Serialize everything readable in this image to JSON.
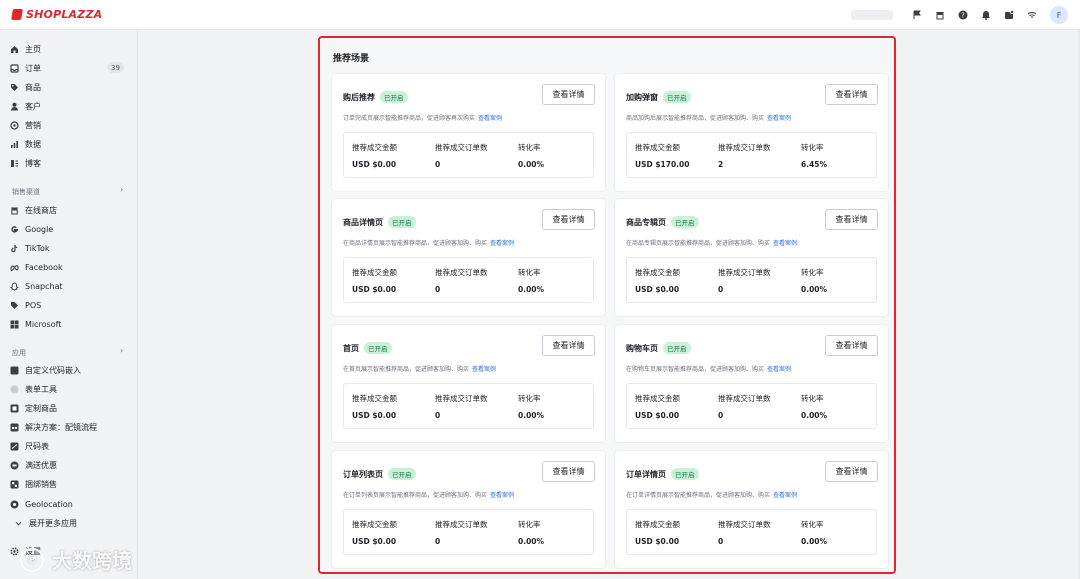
{
  "topbar": {
    "brand": "SHOPLAZZA",
    "avatar_letter": "F"
  },
  "sidebar": {
    "main_items": [
      {
        "label": "主页",
        "icon": "home-icon"
      },
      {
        "label": "订单",
        "icon": "orders-icon",
        "badge": "39"
      },
      {
        "label": "商品",
        "icon": "tag-icon"
      },
      {
        "label": "客户",
        "icon": "person-icon"
      },
      {
        "label": "营销",
        "icon": "marketing-icon"
      },
      {
        "label": "数据",
        "icon": "chart-icon"
      },
      {
        "label": "博客",
        "icon": "blog-icon"
      }
    ],
    "channels_title": "销售渠道",
    "channels": [
      {
        "label": "在线商店",
        "icon": "store-icon"
      },
      {
        "label": "Google",
        "icon": "google-icon"
      },
      {
        "label": "TikTok",
        "icon": "tiktok-icon"
      },
      {
        "label": "Facebook",
        "icon": "meta-icon"
      },
      {
        "label": "Snapchat",
        "icon": "snapchat-icon"
      },
      {
        "label": "POS",
        "icon": "pos-icon"
      },
      {
        "label": "Microsoft",
        "icon": "microsoft-icon"
      }
    ],
    "apps_title": "应用",
    "apps": [
      {
        "label": "自定义代码嵌入",
        "icon": "code-icon"
      },
      {
        "label": "表单工具",
        "icon": "form-icon"
      },
      {
        "label": "定制商品",
        "icon": "custom-product-icon"
      },
      {
        "label": "解决方案：配镜流程",
        "icon": "glasses-icon"
      },
      {
        "label": "尺码表",
        "icon": "size-chart-icon"
      },
      {
        "label": "满送优惠",
        "icon": "gift-icon"
      },
      {
        "label": "捆绑销售",
        "icon": "bundle-icon"
      },
      {
        "label": "Geolocation",
        "icon": "geolocation-icon"
      }
    ],
    "expand_more": "展开更多应用",
    "settings": "设置"
  },
  "main": {
    "section_title": "推荐场景",
    "detail_button": "查看详情",
    "status_label": "已开启",
    "case_link": "查看案例",
    "stat_labels": [
      "推荐成交金额",
      "推荐成交订单数",
      "转化率"
    ],
    "cards": [
      {
        "title": "购后推荐",
        "desc": "订单完成页展示智能推荐商品，促进顾客再次购买",
        "amount": "USD $0.00",
        "orders": "0",
        "rate": "0.00%"
      },
      {
        "title": "加购弹窗",
        "desc": "商品加购后展示智能推荐商品，促进顾客加购、购买",
        "amount": "USD $170.00",
        "orders": "2",
        "rate": "6.45%"
      },
      {
        "title": "商品详情页",
        "desc": "在商品详情页展示智能推荐商品，促进顾客加购、购买",
        "amount": "USD $0.00",
        "orders": "0",
        "rate": "0.00%"
      },
      {
        "title": "商品专辑页",
        "desc": "在商品专辑页展示智能推荐商品，促进顾客加购、购买",
        "amount": "USD $0.00",
        "orders": "0",
        "rate": "0.00%"
      },
      {
        "title": "首页",
        "desc": "在首页展示智能推荐商品，促进顾客加购、购买",
        "amount": "USD $0.00",
        "orders": "0",
        "rate": "0.00%"
      },
      {
        "title": "购物车页",
        "desc": "在购物车页展示智能推荐商品，促进顾客加购、购买",
        "amount": "USD $0.00",
        "orders": "0",
        "rate": "0.00%"
      },
      {
        "title": "订单列表页",
        "desc": "在订单列表页展示智能推荐商品，促进顾客加购、购买",
        "amount": "USD $0.00",
        "orders": "0",
        "rate": "0.00%"
      },
      {
        "title": "订单详情页",
        "desc": "在订单详情页展示智能推荐商品，促进顾客加购、购买",
        "amount": "USD $0.00",
        "orders": "0",
        "rate": "0.00%"
      }
    ]
  },
  "watermark": "大数跨境",
  "colors": {
    "brand": "#e0262f",
    "status_bg": "#c9f1d8",
    "status_text": "#18794e",
    "link": "#2f6fdc",
    "highlight_border": "#e0262f"
  }
}
